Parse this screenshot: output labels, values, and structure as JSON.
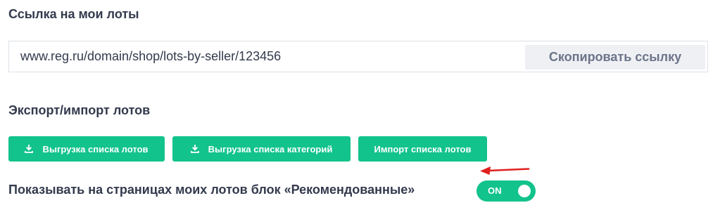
{
  "lots_link": {
    "title": "Ссылка на мои лоты",
    "url_value": "www.reg.ru/domain/shop/lots-by-seller/123456",
    "copy_label": "Скопировать ссылку"
  },
  "export_import": {
    "title": "Экспорт/импорт лотов",
    "buttons": [
      {
        "label": "Выгрузка списка лотов",
        "icon": "download-icon"
      },
      {
        "label": "Выгрузка списка категорий",
        "icon": "download-icon"
      },
      {
        "label": "Импорт списка лотов"
      }
    ]
  },
  "recommended_block": {
    "label": "Показывать на страницах моих лотов блок «Рекомендованные»",
    "toggle_text": "ON",
    "toggle_on": true
  },
  "colors": {
    "primary_green": "#12c38b",
    "text_dark": "#333a4d",
    "annotation_arrow": "#e02020"
  }
}
